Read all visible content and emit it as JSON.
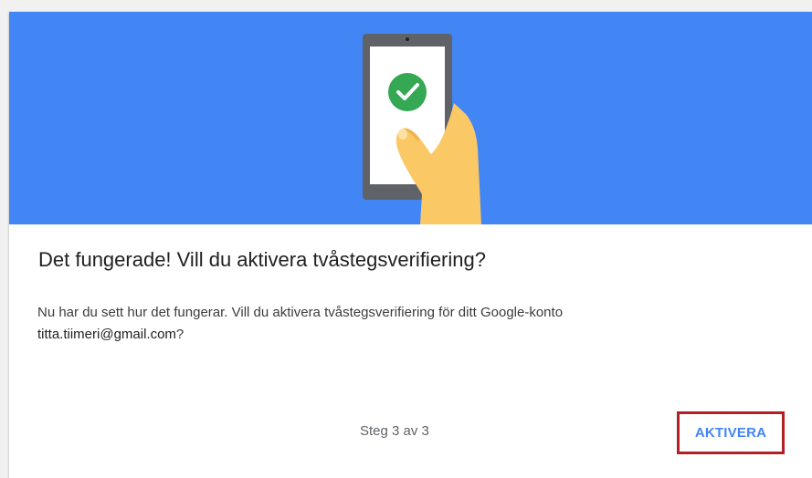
{
  "dialog": {
    "title": "Det fungerade! Vill du aktivera tvåstegsverifiering?",
    "message": "Nu har du sett hur det fungerar. Vill du aktivera tvåstegsverifiering för ditt Google-konto",
    "account_email": "titta.tiimeri@gmail.com",
    "message_suffix": "?",
    "step_label": "Steg 3 av 3",
    "activate_label": "AKTIVERA"
  },
  "illustration": {
    "icon": "phone-with-checkmark-icon",
    "background_color": "#4285f4",
    "check_color": "#34a853"
  },
  "colors": {
    "accent": "#4285f4",
    "highlight_border": "#b02025"
  }
}
